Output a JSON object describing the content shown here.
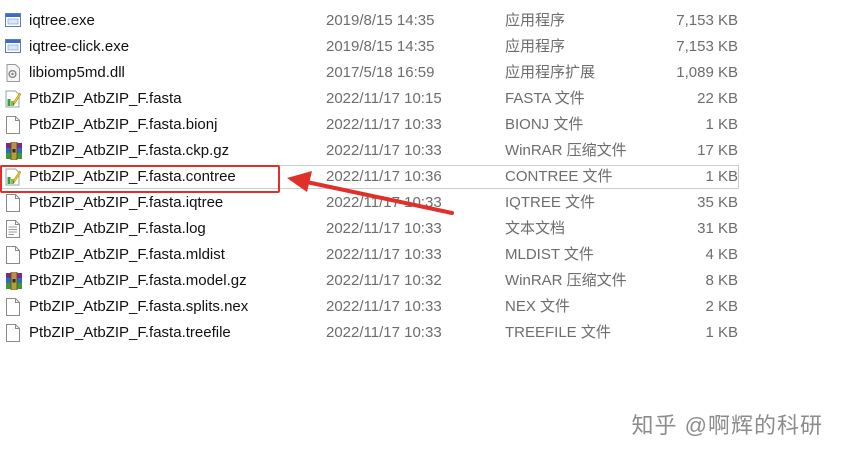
{
  "files": [
    {
      "name": "iqtree.exe",
      "date": "2019/8/15 14:35",
      "type": "应用程序",
      "size": "7,153 KB",
      "icon": "exe-icon"
    },
    {
      "name": "iqtree-click.exe",
      "date": "2019/8/15 14:35",
      "type": "应用程序",
      "size": "7,153 KB",
      "icon": "exe-icon"
    },
    {
      "name": "libiomp5md.dll",
      "date": "2017/5/18 16:59",
      "type": "应用程序扩展",
      "size": "1,089 KB",
      "icon": "dll-icon"
    },
    {
      "name": "PtbZIP_AtbZIP_F.fasta",
      "date": "2022/11/17 10:15",
      "type": "FASTA 文件",
      "size": "22 KB",
      "icon": "editor-file-icon"
    },
    {
      "name": "PtbZIP_AtbZIP_F.fasta.bionj",
      "date": "2022/11/17 10:33",
      "type": "BIONJ 文件",
      "size": "1 KB",
      "icon": "blank-file-icon"
    },
    {
      "name": "PtbZIP_AtbZIP_F.fasta.ckp.gz",
      "date": "2022/11/17 10:33",
      "type": "WinRAR 压缩文件",
      "size": "17 KB",
      "icon": "winrar-archive-icon"
    },
    {
      "name": "PtbZIP_AtbZIP_F.fasta.contree",
      "date": "2022/11/17 10:36",
      "type": "CONTREE 文件",
      "size": "1 KB",
      "icon": "editor-file-icon"
    },
    {
      "name": "PtbZIP_AtbZIP_F.fasta.iqtree",
      "date": "2022/11/17 10:33",
      "type": "IQTREE 文件",
      "size": "35 KB",
      "icon": "blank-file-icon"
    },
    {
      "name": "PtbZIP_AtbZIP_F.fasta.log",
      "date": "2022/11/17 10:33",
      "type": "文本文档",
      "size": "31 KB",
      "icon": "text-file-icon"
    },
    {
      "name": "PtbZIP_AtbZIP_F.fasta.mldist",
      "date": "2022/11/17 10:33",
      "type": "MLDIST 文件",
      "size": "4 KB",
      "icon": "blank-file-icon"
    },
    {
      "name": "PtbZIP_AtbZIP_F.fasta.model.gz",
      "date": "2022/11/17 10:32",
      "type": "WinRAR 压缩文件",
      "size": "8 KB",
      "icon": "winrar-archive-icon"
    },
    {
      "name": "PtbZIP_AtbZIP_F.fasta.splits.nex",
      "date": "2022/11/17 10:33",
      "type": "NEX 文件",
      "size": "2 KB",
      "icon": "blank-file-icon"
    },
    {
      "name": "PtbZIP_AtbZIP_F.fasta.treefile",
      "date": "2022/11/17 10:33",
      "type": "TREEFILE 文件",
      "size": "1 KB",
      "icon": "blank-file-icon"
    }
  ],
  "selected_file": "PtbZIP_AtbZIP_F.fasta.contree",
  "annotation_color": "#e0302a",
  "watermark": "知乎 @啊辉的科研"
}
